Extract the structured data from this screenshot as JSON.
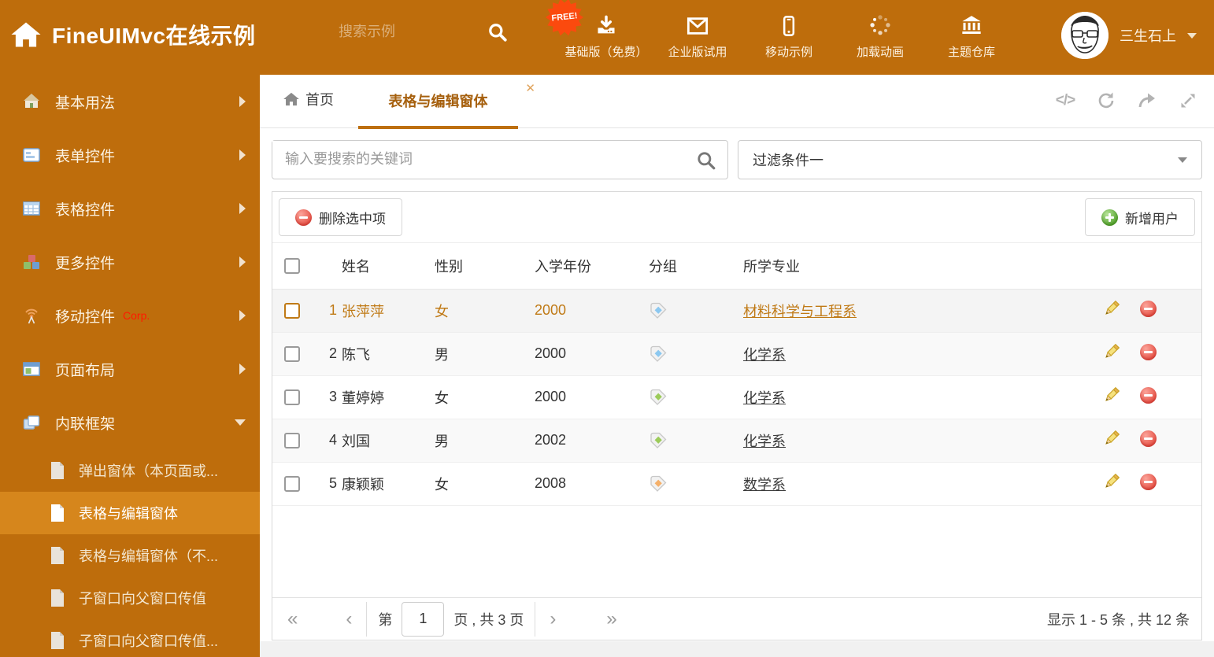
{
  "header": {
    "title": "FineUIMvc在线示例",
    "search_placeholder": "搜索示例",
    "free_badge": "FREE!",
    "nav": [
      {
        "label": "基础版（免费）",
        "icon": "download-icon"
      },
      {
        "label": "企业版试用",
        "icon": "mail-icon"
      },
      {
        "label": "移动示例",
        "icon": "mobile-icon"
      },
      {
        "label": "加载动画",
        "icon": "spinner-icon"
      },
      {
        "label": "主题仓库",
        "icon": "bank-icon"
      }
    ],
    "user": {
      "name": "三生石上"
    }
  },
  "sidebar": {
    "items": [
      {
        "label": "基本用法"
      },
      {
        "label": "表单控件"
      },
      {
        "label": "表格控件"
      },
      {
        "label": "更多控件"
      },
      {
        "label": "移动控件",
        "badge": "Corp."
      },
      {
        "label": "页面布局"
      },
      {
        "label": "内联框架",
        "expanded": true
      }
    ],
    "subitems": [
      {
        "label": "弹出窗体（本页面或..."
      },
      {
        "label": "表格与编辑窗体",
        "active": true
      },
      {
        "label": "表格与编辑窗体（不..."
      },
      {
        "label": "子窗口向父窗口传值"
      },
      {
        "label": "子窗口向父窗口传值..."
      }
    ]
  },
  "tabs": {
    "home": "首页",
    "active": "表格与编辑窗体"
  },
  "filters": {
    "search_placeholder": "输入要搜索的关键词",
    "filter_value": "过滤条件一"
  },
  "toolbar": {
    "delete_label": "删除选中项",
    "add_label": "新增用户"
  },
  "table": {
    "headers": [
      "姓名",
      "性别",
      "入学年份",
      "分组",
      "所学专业"
    ],
    "rows": [
      {
        "num": "1",
        "name": "张萍萍",
        "gender": "女",
        "year": "2000",
        "tag": "blue",
        "major": "材料科学与工程系",
        "selected": true
      },
      {
        "num": "2",
        "name": "陈飞",
        "gender": "男",
        "year": "2000",
        "tag": "blue",
        "major": "化学系"
      },
      {
        "num": "3",
        "name": "董婷婷",
        "gender": "女",
        "year": "2000",
        "tag": "green",
        "major": "化学系"
      },
      {
        "num": "4",
        "name": "刘国",
        "gender": "男",
        "year": "2002",
        "tag": "green",
        "major": "化学系"
      },
      {
        "num": "5",
        "name": "康颖颖",
        "gender": "女",
        "year": "2008",
        "tag": "orange",
        "major": "数学系"
      }
    ]
  },
  "pagination": {
    "prefix": "第",
    "page": "1",
    "suffix": "页 , 共 3 页",
    "summary": "显示 1 - 5 条 , 共 12 条"
  },
  "colors": {
    "accent": "#BE6D0C",
    "accent_light": "#D6861C",
    "free_badge": "#FB4A0E",
    "tag_blue": "#8CC8F0",
    "tag_green": "#9CCB5A",
    "tag_orange": "#F5B06A",
    "selected_text": "#C07A16"
  }
}
